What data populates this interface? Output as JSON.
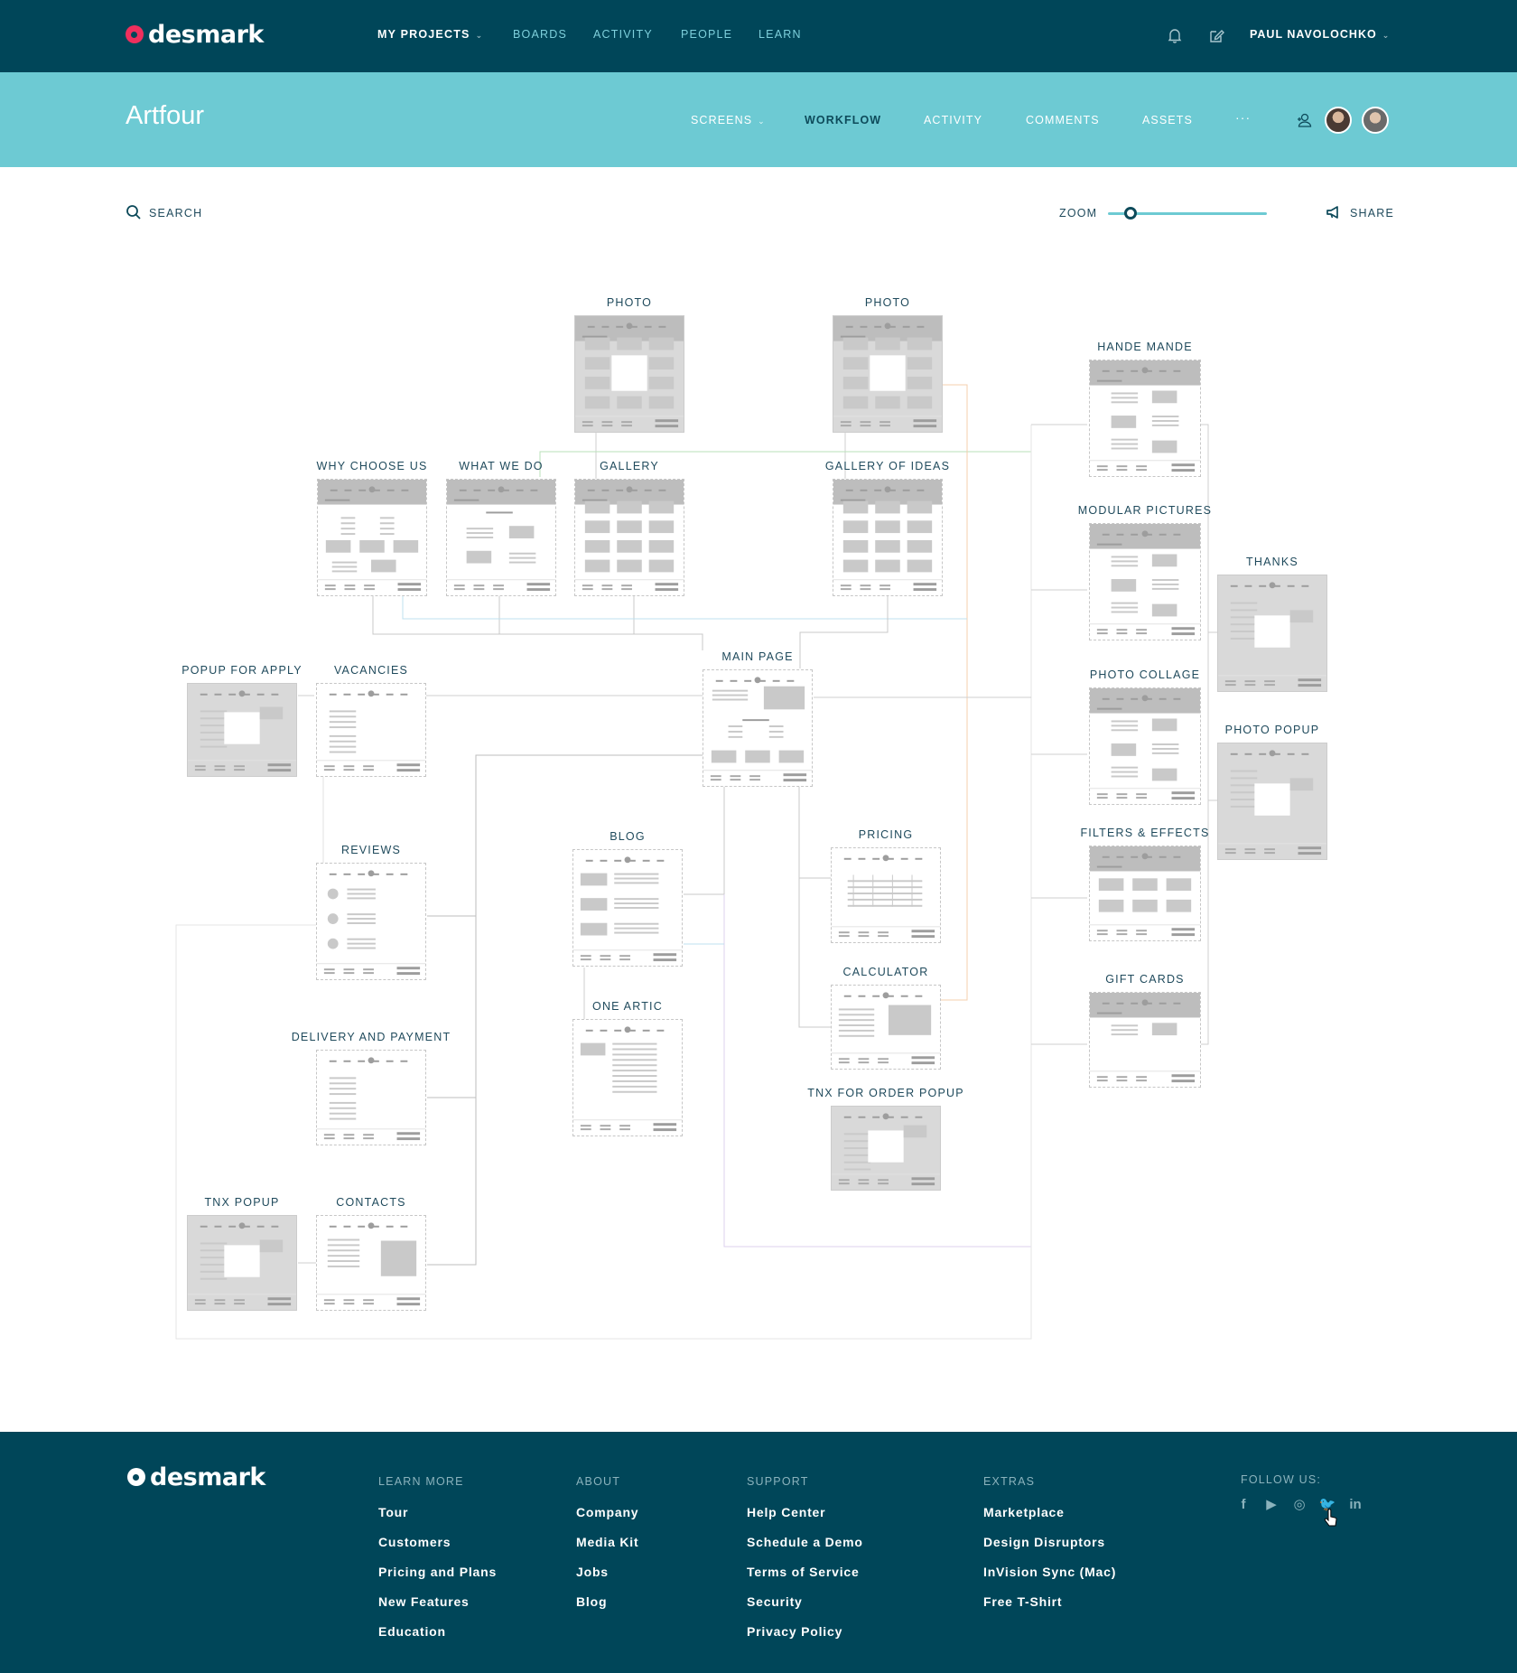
{
  "app": {
    "logo_text": "desmark",
    "brand_color": "#ef2f5d",
    "topbar_color": "#004659",
    "accent_color": "#6dcad3"
  },
  "topnav": {
    "items": [
      {
        "label": "MY PROJECTS",
        "active": true,
        "has_caret": true
      },
      {
        "label": "BOARDS"
      },
      {
        "label": "ACTIVITY"
      },
      {
        "label": "PEOPLE"
      },
      {
        "label": "LEARN"
      }
    ],
    "icons": [
      "bell-icon",
      "edit-icon"
    ],
    "user_name": "PAUL NAVOLOCHKO"
  },
  "project": {
    "title": "Artfour",
    "tabs": [
      {
        "label": "SCREENS",
        "has_caret": true
      },
      {
        "label": "WORKFLOW",
        "active": true
      },
      {
        "label": "ACTIVITY"
      },
      {
        "label": "COMMENTS"
      },
      {
        "label": "ASSETS"
      },
      {
        "label": "···"
      }
    ]
  },
  "toolbar": {
    "search_label": "SEARCH",
    "zoom_label": "ZOOM",
    "zoom_level": 0.14,
    "share_label": "SHARE"
  },
  "screens": [
    {
      "id": "photo-1",
      "label": "PHOTO",
      "variant": "gallery-popup"
    },
    {
      "id": "photo-2",
      "label": "PHOTO",
      "variant": "gallery-popup"
    },
    {
      "id": "why-choose-us",
      "label": "WHY CHOOSE US",
      "variant": "features"
    },
    {
      "id": "what-we-do",
      "label": "WHAT WE DO",
      "variant": "content"
    },
    {
      "id": "gallery",
      "label": "GALLERY",
      "variant": "grid"
    },
    {
      "id": "gallery-of-ideas",
      "label": "GALLERY OF IDEAS",
      "variant": "grid"
    },
    {
      "id": "hande-mande",
      "label": "HANDE MANDE",
      "variant": "article"
    },
    {
      "id": "modular-pictures",
      "label": "MODULAR PICTURES",
      "variant": "article"
    },
    {
      "id": "thanks",
      "label": "THANKS",
      "variant": "popup"
    },
    {
      "id": "photo-collage",
      "label": "PHOTO COLLAGE",
      "variant": "article"
    },
    {
      "id": "photo-popup",
      "label": "PHOTO POPUP",
      "variant": "popup"
    },
    {
      "id": "filters-effects",
      "label": "FILTERS & EFFECTS",
      "variant": "grid-small"
    },
    {
      "id": "gift-cards",
      "label": "GIFT CARDS",
      "variant": "simple"
    },
    {
      "id": "popup-for-apply",
      "label": "POPUP FOR APPLY",
      "variant": "popup"
    },
    {
      "id": "vacancies",
      "label": "VACANCIES",
      "variant": "list"
    },
    {
      "id": "main-page",
      "label": "MAIN PAGE",
      "variant": "home"
    },
    {
      "id": "reviews",
      "label": "REVIEWS",
      "variant": "reviews"
    },
    {
      "id": "blog",
      "label": "BLOG",
      "variant": "blog"
    },
    {
      "id": "pricing",
      "label": "PRICING",
      "variant": "table"
    },
    {
      "id": "one-artic",
      "label": "ONE ARTIC",
      "variant": "article-single"
    },
    {
      "id": "calculator",
      "label": "CALCULATOR",
      "variant": "calc"
    },
    {
      "id": "delivery-and-payment",
      "label": "DELIVERY AND PAYMENT",
      "variant": "list"
    },
    {
      "id": "tnx-for-order-popup",
      "label": "TNX FOR ORDER POPUP",
      "variant": "popup"
    },
    {
      "id": "tnx-popup",
      "label": "TNX POPUP",
      "variant": "popup"
    },
    {
      "id": "contacts",
      "label": "CONTACTS",
      "variant": "contacts"
    }
  ],
  "footer": {
    "columns": [
      {
        "heading": "LEARN MORE",
        "links": [
          "Tour",
          "Customers",
          "Pricing and Plans",
          "New Features",
          "Education"
        ]
      },
      {
        "heading": "ABOUT",
        "links": [
          "Company",
          "Media Kit",
          "Jobs",
          "Blog"
        ]
      },
      {
        "heading": "SUPPORT",
        "links": [
          "Help Center",
          "Schedule a Demo",
          "Terms of Service",
          "Security",
          "Privacy Policy"
        ]
      },
      {
        "heading": "EXTRAS",
        "links": [
          "Marketplace",
          "Design Disruptors",
          "InVision Sync (Mac)",
          "Free T-Shirt"
        ]
      }
    ],
    "follow_label": "FOLLOW US:",
    "social": [
      {
        "icon": "facebook-icon",
        "glyph": "f"
      },
      {
        "icon": "youtube-icon",
        "glyph": "▶"
      },
      {
        "icon": "instagram-icon",
        "glyph": "◎"
      },
      {
        "icon": "twitter-icon",
        "glyph": "🐦",
        "hovered": true
      },
      {
        "icon": "linkedin-icon",
        "glyph": "in"
      }
    ]
  }
}
